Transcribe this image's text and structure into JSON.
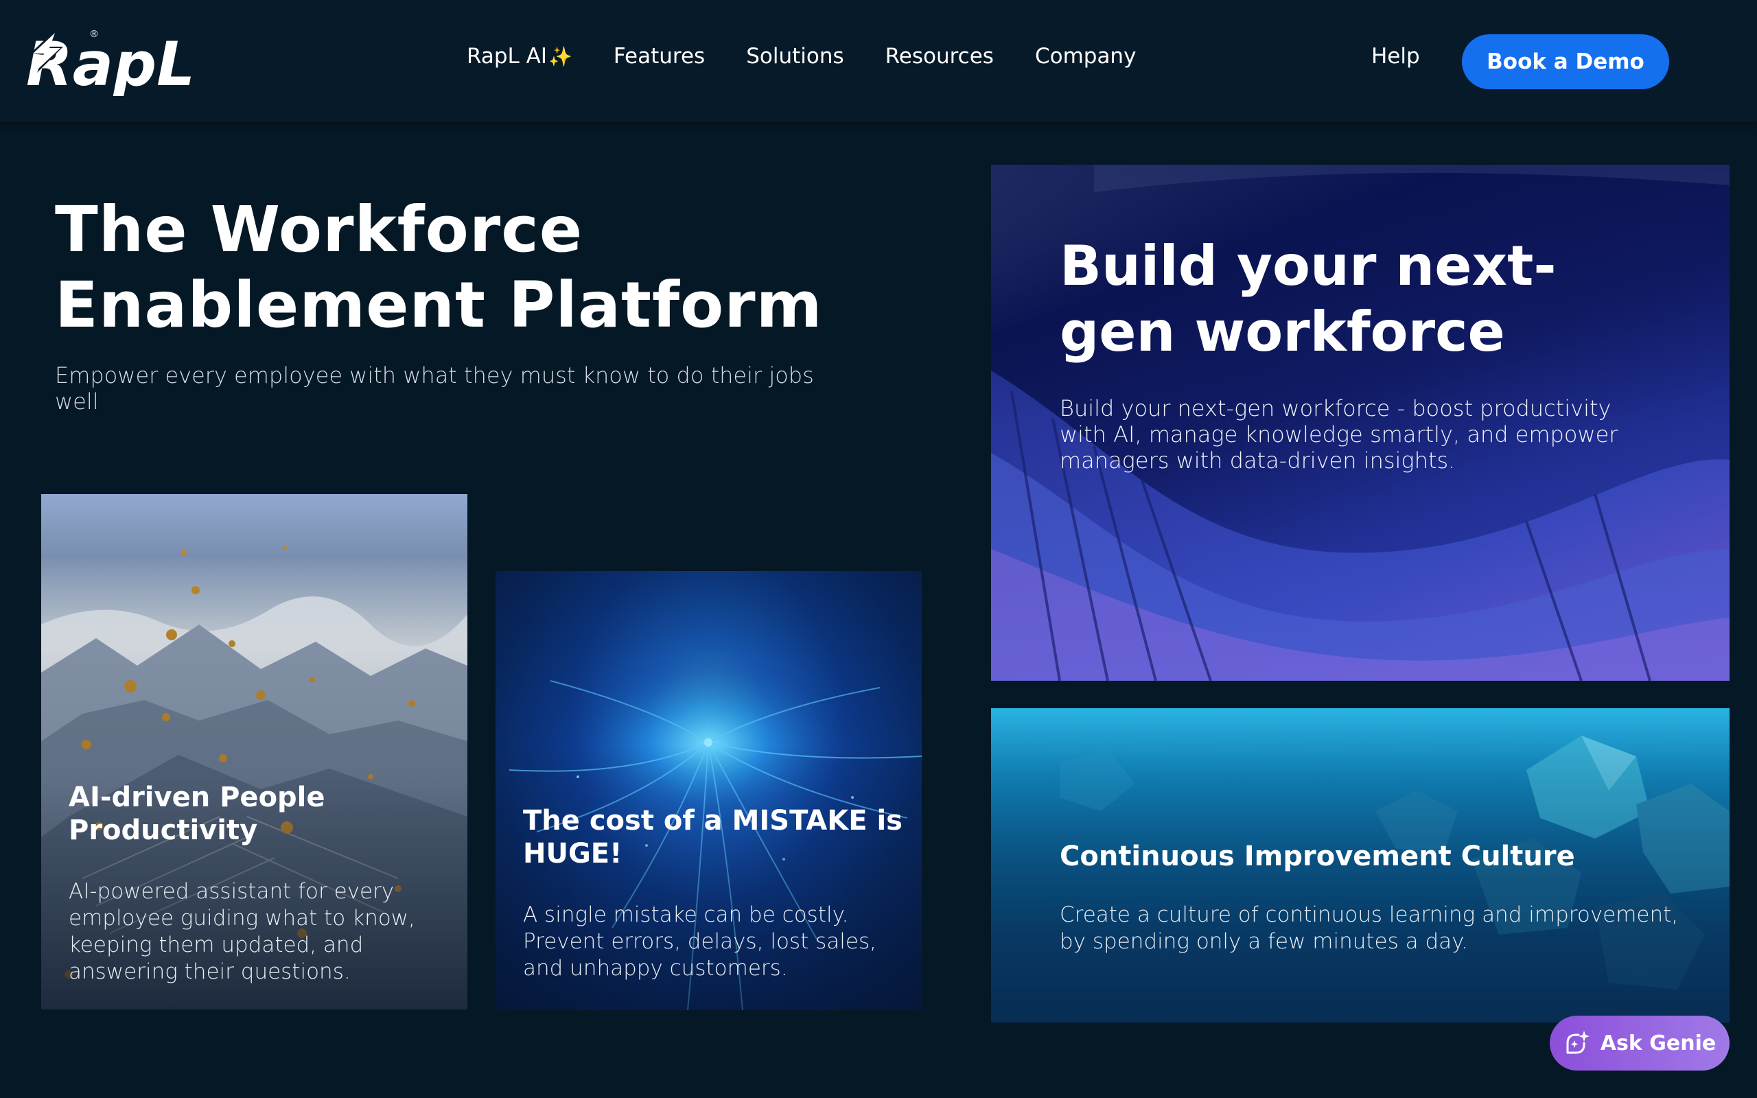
{
  "brand": {
    "logo_text": "RapL",
    "registered_mark": "®"
  },
  "nav": {
    "items": [
      {
        "label": "RapL AI",
        "icon": "sparkle-icon",
        "suffix": "✨"
      },
      {
        "label": "Features"
      },
      {
        "label": "Solutions"
      },
      {
        "label": "Resources"
      },
      {
        "label": "Company"
      }
    ],
    "help_label": "Help",
    "cta_label": "Book a Demo"
  },
  "hero": {
    "title_line1": "The Workforce",
    "title_line2": "Enablement Platform",
    "subtitle": "Empower every employee with what they must know to do their jobs well"
  },
  "cards": {
    "ai": {
      "title": "AI-driven People Productivity",
      "description": "AI-powered assistant for every employee guiding what to know, keeping them updated, and answering their questions."
    },
    "mistake": {
      "title": "The cost of a MISTAKE is HUGE!",
      "description": "A single mistake can be costly. Prevent errors, delays, lost sales, and unhappy customers."
    },
    "build": {
      "title": "Build your next-gen workforce",
      "description": "Build your next-gen workforce - boost productivity with AI, manage knowledge smartly, and empower managers with data-driven insights."
    },
    "culture": {
      "title": "Continuous Improvement Culture",
      "description": "Create a culture of continuous learning and improvement, by spending only a few minutes a day."
    }
  },
  "genie": {
    "label": "Ask Genie",
    "icon": "genie-sparkle-icon"
  },
  "colors": {
    "background": "#051826",
    "nav_background": "#071a29",
    "primary_button": "#1570ef",
    "genie_gradient_start": "#8c4fd9",
    "genie_gradient_end": "#a07ae8"
  }
}
